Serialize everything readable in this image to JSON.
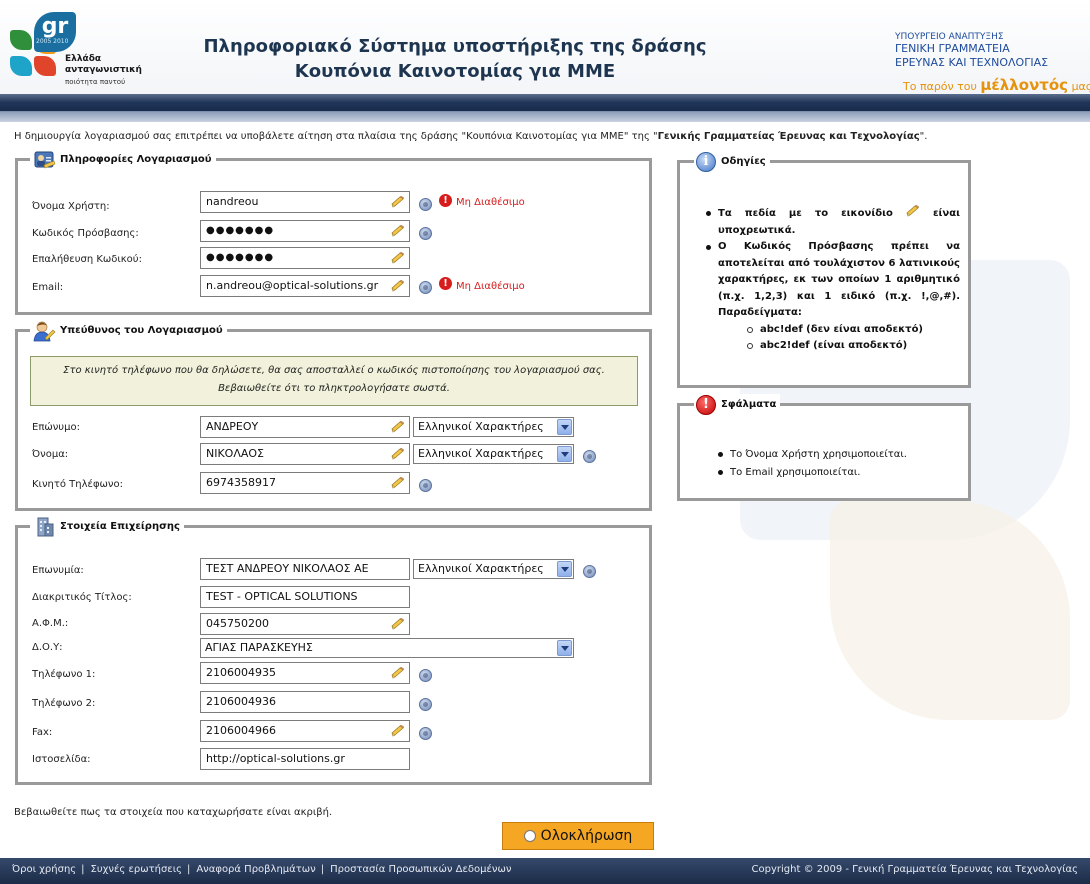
{
  "header": {
    "logo": {
      "brand": "gr",
      "years": "2005 2010",
      "line1": "Ελλάδα",
      "line2": "ανταγωνιστική",
      "line3": "ποιότητα παντού"
    },
    "title_line1": "Πληροφοριακό Σύστημα υποστήριξης της δράσης",
    "title_line2": "Κουπόνια Καινοτομίας για ΜΜΕ",
    "ministry": {
      "line1": "ΥΠΟΥΡΓΕΙΟ ΑΝΑΠΤΥΞΗΣ",
      "line2": "ΓΕΝΙΚΗ ΓΡΑΜΜΑΤΕΙΑ",
      "line3": "ΕΡΕΥΝΑΣ ΚΑΙ ΤΕΧΝΟΛΟΓΙΑΣ",
      "tagline_pre": "Το παρόν του",
      "tagline_big": "μέλλοντός",
      "tagline_post": "μας"
    }
  },
  "intro": {
    "text_pre": "Η δημιουργία λογαριασμού σας επιτρέπει να υποβάλετε αίτηση στα πλαίσια της δράσης \"Κουπόνια Καινοτομίας για ΜΜΕ\" της \"",
    "text_bold": "Γενικής Γραμματείας Έρευνας και Τεχνολογίας",
    "text_post": "\"."
  },
  "account": {
    "legend": "Πληροφορίες Λογαριασμού",
    "username_label": "Όνομα Χρήστη:",
    "username_value": "nandreou",
    "username_error": "Μη Διαθέσιμο",
    "password_label": "Κωδικός Πρόσβασης:",
    "password_value": "●●●●●●●",
    "confirm_label": "Επαλήθευση Κωδικού:",
    "confirm_value": "●●●●●●●",
    "email_label": "Email:",
    "email_value": "n.andreou@optical-solutions.gr",
    "email_error": "Μη Διαθέσιμο"
  },
  "responsible": {
    "legend": "Υπεύθυνος του Λογαριασμού",
    "notice_line1": "Στο κινητό τηλέφωνο που θα δηλώσετε, θα σας αποσταλλεί ο κωδικός πιστοποίησης του λογαριασμού σας.",
    "notice_line2": "Βεβαιωθείτε ότι το πληκτρολογήσατε σωστά.",
    "surname_label": "Επώνυμο:",
    "surname_value": "ΑΝΔΡΕΟΥ",
    "surname_charset": "Ελληνικοί Χαρακτήρες",
    "name_label": "Όνομα:",
    "name_value": "ΝΙΚΟΛΑΟΣ",
    "name_charset": "Ελληνικοί Χαρακτήρες",
    "mobile_label": "Κινητό Τηλέφωνο:",
    "mobile_value": "6974358917"
  },
  "business": {
    "legend": "Στοιχεία Επιχείρησης",
    "company_label": "Επωνυμία:",
    "company_value": "ΤΕΣΤ ΑΝΔΡΕΟΥ ΝΙΚΟΛΑΟΣ ΑΕ",
    "company_charset": "Ελληνικοί Χαρακτήρες",
    "trade_label": "Διακριτικός Τίτλος:",
    "trade_value": "TEST - OPTICAL SOLUTIONS",
    "afm_label": "Α.Φ.Μ.:",
    "afm_value": "045750200",
    "doy_label": "Δ.Ο.Υ:",
    "doy_value": "ΑΓΙΑΣ ΠΑΡΑΣΚΕΥΗΣ",
    "phone1_label": "Τηλέφωνο 1:",
    "phone1_value": "2106004935",
    "phone2_label": "Τηλέφωνο 2:",
    "phone2_value": "2106004936",
    "fax_label": "Fax:",
    "fax_value": "2106004966",
    "web_label": "Ιστοσελίδα:",
    "web_value": "http://optical-solutions.gr"
  },
  "instructions": {
    "legend": "Οδηγίες",
    "item1_pre": "Τα πεδία με το εικονίδιο",
    "item1_post": "είναι υποχρεωτικά.",
    "item2": "Ο Κωδικός Πρόσβασης πρέπει να αποτελείται από τουλάχιστον 6 λατινικούς χαρακτήρες, εκ των οποίων 1 αριθμητικό (π.χ. 1,2,3) και 1 ειδικό (π.χ. !,@,#). Παραδείγματα:",
    "example1": "abc!def   (δεν είναι αποδεκτό)",
    "example2": "abc2!def (είναι αποδεκτό)"
  },
  "errors": {
    "legend": "Σφάλματα",
    "item1": "Το Όνομα Χρήστη χρησιμοποιείται.",
    "item2": "Το Email χρησιμοποιείται."
  },
  "verify_text": "Βεβαιωθείτε πως τα στοιχεία που καταχωρήσατε είναι ακριβή.",
  "submit_label": "Ολοκλήρωση",
  "footer": {
    "link1": "Όροι χρήσης",
    "link2": "Συχνές ερωτήσεις",
    "link3": "Αναφορά Προβλημάτων",
    "link4": "Προστασία Προσωπικών Δεδομένων",
    "copyright": "Copyright © 2009 - Γενική Γραμματεία Έρευνας και Τεχνολογίας"
  },
  "colors": {
    "error_red": "#d81c1c",
    "submit_orange": "#f5a623",
    "nav_dark": "#1c2c48",
    "title_blue": "#1e3550"
  }
}
